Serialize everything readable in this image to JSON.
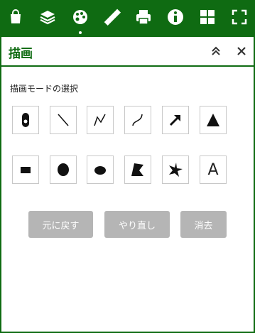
{
  "toolbar": {
    "icons": [
      "shopping-bag-icon",
      "layers-icon",
      "palette-icon",
      "ruler-icon",
      "printer-icon",
      "info-icon",
      "grid-icon",
      "fullscreen-icon"
    ]
  },
  "panel": {
    "title": "描画",
    "section_label": "描画モードの選択",
    "text_tool_label": "A"
  },
  "buttons": {
    "undo": "元に戻す",
    "redo": "やり直し",
    "delete": "消去"
  },
  "colors": {
    "primary_green": "#0f6b12",
    "disabled_button": "#b5b5b5"
  }
}
